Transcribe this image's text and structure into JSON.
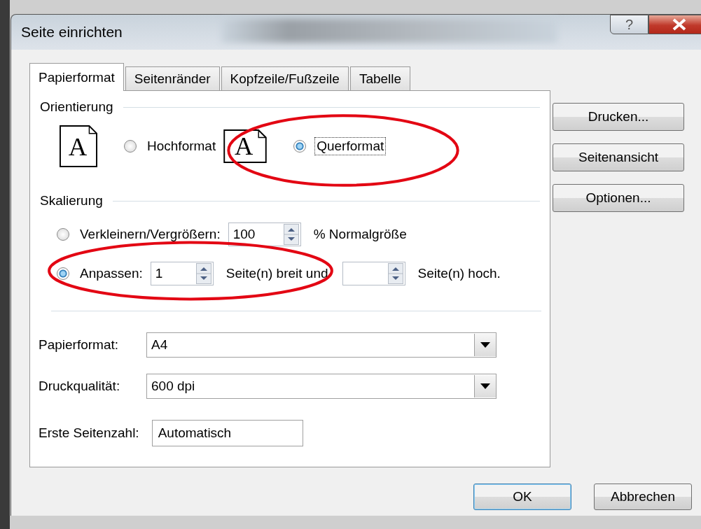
{
  "window": {
    "title": "Seite einrichten",
    "help_label": "?"
  },
  "tabs": [
    {
      "label": "Papierformat",
      "selected": true
    },
    {
      "label": "Seitenränder",
      "selected": false
    },
    {
      "label": "Kopfzeile/Fußzeile",
      "selected": false
    },
    {
      "label": "Tabelle",
      "selected": false
    }
  ],
  "orientation": {
    "title": "Orientierung",
    "options": [
      {
        "kind": "portrait",
        "glyph": "A",
        "label": "Hochformat",
        "selected": false,
        "focused": false,
        "highlighted": false
      },
      {
        "kind": "landscape",
        "glyph": "A",
        "label": "Querformat",
        "selected": true,
        "focused": true,
        "highlighted": true
      }
    ]
  },
  "scaling": {
    "title": "Skalierung",
    "adjust": {
      "label": "Verkleinern/Vergrößern:",
      "selected": false,
      "value": "100",
      "suffix": "% Normalgröße"
    },
    "fit": {
      "label": "Anpassen:",
      "selected": true,
      "highlighted": true,
      "wide_value": "1",
      "wide_suffix": "Seite(n) breit und",
      "tall_suffix": "Seite(n) hoch."
    }
  },
  "dropdowns": [
    {
      "label": "Papierformat:",
      "value": "A4"
    },
    {
      "label": "Druckqualität:",
      "value": "600 dpi"
    }
  ],
  "first_page": {
    "label": "Erste Seitenzahl:",
    "value": "Automatisch"
  },
  "side_buttons": [
    "Drucken...",
    "Seitenansicht",
    "Optionen..."
  ],
  "footer_buttons": [
    {
      "label": "OK",
      "default": true
    },
    {
      "label": "Abbrechen",
      "default": false
    }
  ]
}
